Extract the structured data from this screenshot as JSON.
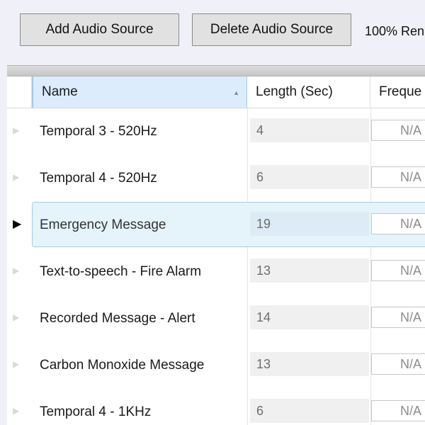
{
  "toolbar": {
    "add_label": "Add Audio Source",
    "delete_label": "Delete Audio Source",
    "render_text": "100% Ren"
  },
  "columns": {
    "name": "Name",
    "length": "Length (Sec)",
    "frequency": "Freque"
  },
  "rows": [
    {
      "name": "Temporal 3 - 520Hz",
      "length": "4",
      "frequency": "N/A",
      "selected": false
    },
    {
      "name": "Temporal 4 - 520Hz",
      "length": "6",
      "frequency": "N/A",
      "selected": false
    },
    {
      "name": "Emergency Message",
      "length": "19",
      "frequency": "N/A",
      "selected": true
    },
    {
      "name": "Text-to-speech - Fire Alarm",
      "length": "13",
      "frequency": "N/A",
      "selected": false
    },
    {
      "name": "Recorded Message - Alert",
      "length": "14",
      "frequency": "N/A",
      "selected": false
    },
    {
      "name": "Carbon Monoxide Message",
      "length": "13",
      "frequency": "N/A",
      "selected": false
    },
    {
      "name": "Temporal 4 - 1KHz",
      "length": "6",
      "frequency": "N/A",
      "selected": false
    }
  ],
  "icons": {
    "sort": "sort-ascending-icon",
    "row_indicator": "row-indicator-triangle-icon"
  },
  "colors": {
    "selection_bg": "#e5f3fb",
    "selection_border": "#99d1ef",
    "header_sorted_bg": "#dcecfc"
  }
}
